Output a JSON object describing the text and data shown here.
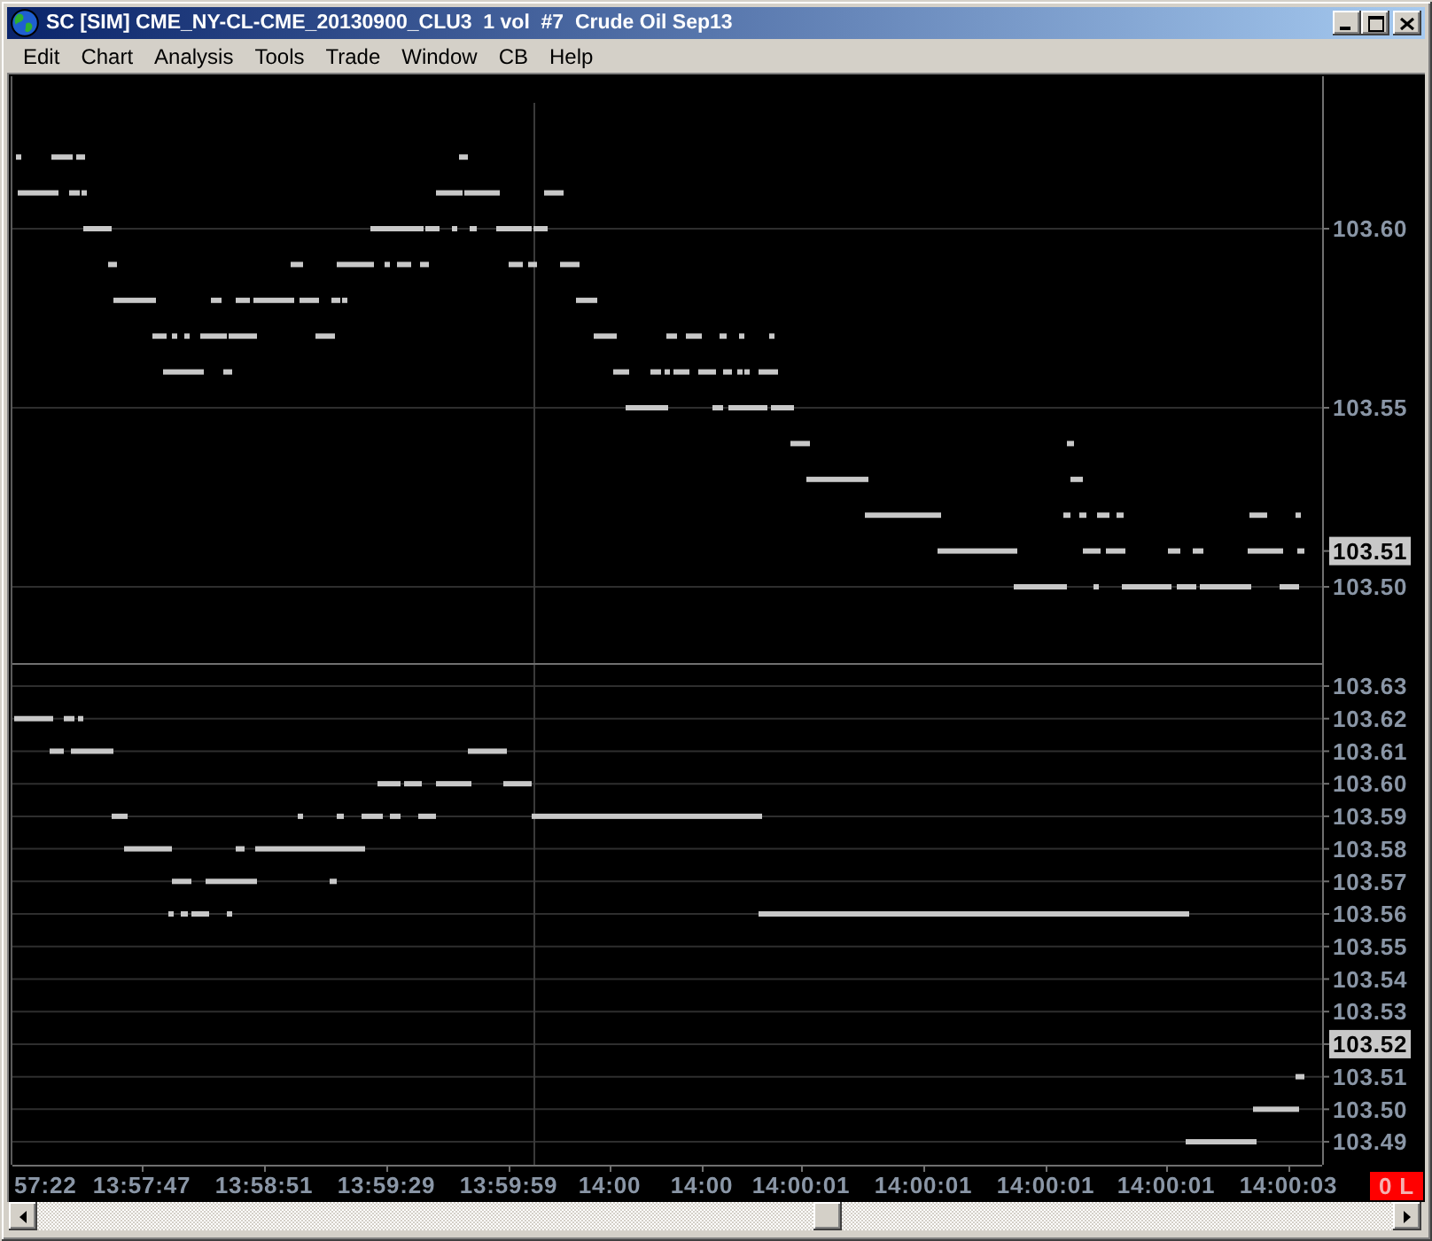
{
  "window": {
    "title": "SC [SIM] CME_NY-CL-CME_20130900_CLU3  1 vol  #7  Crude Oil Sep13"
  },
  "menu": [
    "Edit",
    "Chart",
    "Analysis",
    "Tools",
    "Trade",
    "Window",
    "CB",
    "Help"
  ],
  "chart": {
    "top_panel": {
      "price_labels": [
        "103.60",
        "103.55",
        "103.50"
      ],
      "last_price": "103.51"
    },
    "bottom_panel": {
      "price_labels": [
        {
          "text": "103.63",
          "last_price": false
        },
        {
          "text": "103.62",
          "last_price": false
        },
        {
          "text": "103.61",
          "last_price": false
        },
        {
          "text": "103.60",
          "last_price": false
        },
        {
          "text": "103.59",
          "last_price": false
        },
        {
          "text": "103.58",
          "last_price": false
        },
        {
          "text": "103.57",
          "last_price": false
        },
        {
          "text": "103.56",
          "last_price": false
        },
        {
          "text": "103.55",
          "last_price": false
        },
        {
          "text": "103.54",
          "last_price": false
        },
        {
          "text": "103.53",
          "last_price": false
        },
        {
          "text": "103.52",
          "last_price": true
        },
        {
          "text": "103.51",
          "last_price": false
        },
        {
          "text": "103.50",
          "last_price": false
        },
        {
          "text": "103.49",
          "last_price": false
        }
      ]
    },
    "time_labels": [
      "57:22",
      "13:57:47",
      "13:58:51",
      "13:59:29",
      "13:59:59",
      "14:00",
      "14:00",
      "14:00:01",
      "14:00:01",
      "14:00:01",
      "14:00:01",
      "14:00:03"
    ],
    "status_badge": "0 L"
  }
}
